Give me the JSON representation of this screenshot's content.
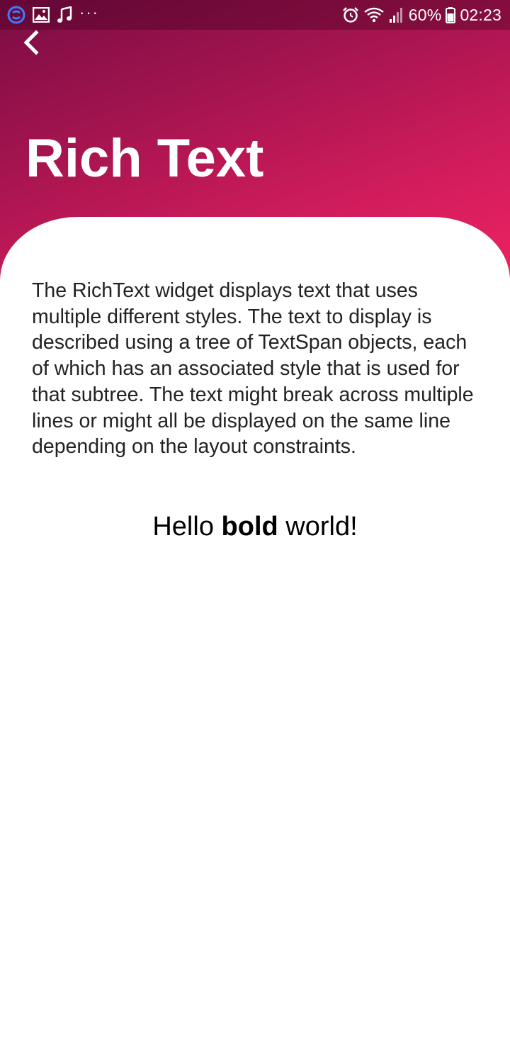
{
  "status_bar": {
    "left_icons": [
      "sync-icon",
      "image-icon",
      "music-note-icon",
      "more-dots-icon"
    ],
    "right_icons": [
      "alarm-icon",
      "wifi-icon",
      "signal-icon",
      "battery-icon"
    ],
    "battery_percent": "60%",
    "time": "02:23",
    "more_dots": "···"
  },
  "header": {
    "back_icon": "chevron-left-icon",
    "title": "Rich Text",
    "gradient_colors": [
      "#7a0c44",
      "#a3144e",
      "#d01c5c",
      "#ee2262"
    ]
  },
  "content": {
    "description": "The RichText widget displays text that uses multiple different styles. The text to display is described using a tree of TextSpan objects, each of which has an associated style that is used for that subtree. The text might break across multiple lines or might all be displayed on the same line depending on the layout constraints.",
    "rich_text": {
      "before": "Hello ",
      "bold": "bold",
      "after": " world!"
    }
  }
}
